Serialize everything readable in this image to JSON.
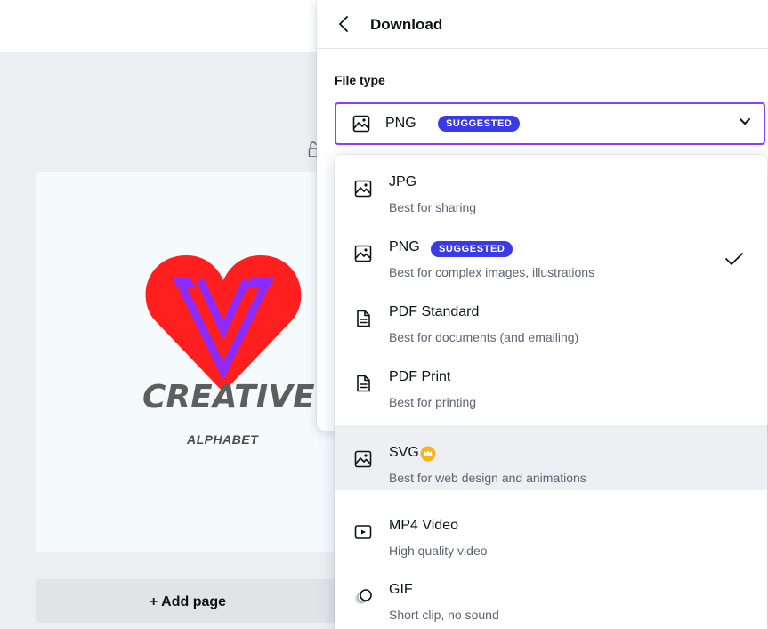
{
  "panel": {
    "title": "Download",
    "file_type_label": "File type",
    "selected_value": "PNG",
    "selected_badge": "SUGGESTED"
  },
  "options": [
    {
      "name": "JPG",
      "desc": "Best for sharing",
      "icon": "image-icon"
    },
    {
      "name": "PNG",
      "desc": "Best for complex images, illustrations",
      "badge": "SUGGESTED",
      "selected": true,
      "icon": "image-icon"
    },
    {
      "name": "PDF Standard",
      "desc": "Best for documents (and emailing)",
      "icon": "document-icon"
    },
    {
      "name": "PDF Print",
      "desc": "Best for printing",
      "icon": "document-icon"
    },
    {
      "name": "SVG",
      "desc": "Best for web design and animations",
      "premium": true,
      "icon": "image-icon"
    },
    {
      "name": "MP4 Video",
      "desc": "High quality video",
      "icon": "video-icon"
    },
    {
      "name": "GIF",
      "desc": "Short clip, no sound",
      "icon": "gif-icon"
    }
  ],
  "canvas": {
    "logo_title": "CREATIVE",
    "logo_subtitle": "ALPHABET",
    "add_page": "+ Add page"
  },
  "colors": {
    "accent_purple": "#8b3dff",
    "badge_blue": "#3a3ae6",
    "premium_gold": "#f8b21d",
    "heart_red": "#ff1f1f",
    "logo_violet": "#8c2bff"
  }
}
